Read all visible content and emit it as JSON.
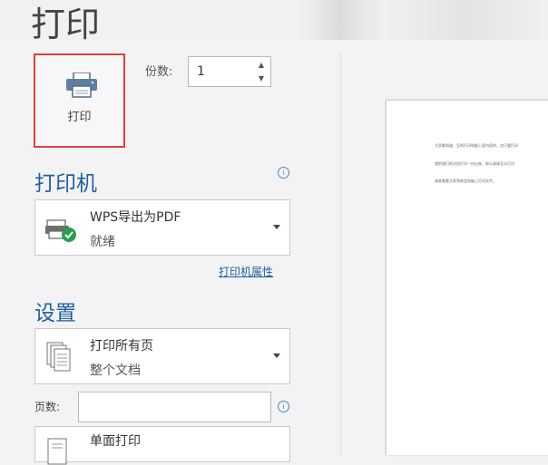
{
  "title": "打印",
  "print_button": {
    "label": "打印",
    "icon": "printer-icon"
  },
  "copies": {
    "label": "份数:",
    "value": "1"
  },
  "printer_section": {
    "title": "打印机",
    "selected": {
      "name": "WPS导出为PDF",
      "status": "就绪",
      "icon": "pdf-printer-icon"
    },
    "properties_link": "打印机属性"
  },
  "settings_section": {
    "title": "设置",
    "range": {
      "line1": "打印所有页",
      "line2": "整个文档",
      "icon": "pages-icon"
    },
    "pages_label": "页数:",
    "pages_value": "",
    "sides": {
      "line1": "单面打印",
      "icon": "single-side-icon"
    }
  },
  "preview": {
    "lines": [
      "大家都知道，怎样打印电脑上面内容的，也只要打印",
      "就把我们的文档打印一份出来，那么具体怎么打印",
      "请来看看大家到底会电脑上打印文件。"
    ]
  },
  "colors": {
    "accent": "#1e5fa8",
    "highlight_border": "#e04040",
    "status_green": "#27a149"
  }
}
